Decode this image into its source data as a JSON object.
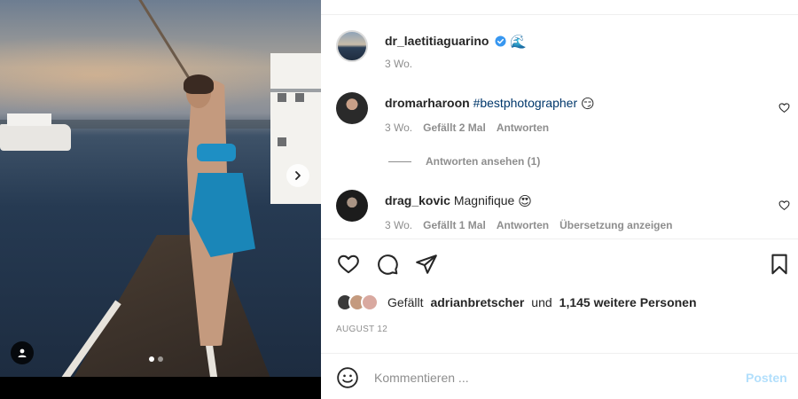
{
  "post": {
    "author": "dr_laetitiaguarino",
    "author_emoji": "🌊",
    "time": "3 Wo."
  },
  "comments": [
    {
      "username": "dromarharoon",
      "text": "#bestphotographer",
      "emoji": "😏",
      "time": "3 Wo.",
      "likes": "Gefällt 2 Mal",
      "reply": "Antworten"
    },
    {
      "username": "drag_kovic",
      "text": "Magnifique",
      "emoji": "😍",
      "time": "3 Wo.",
      "likes": "Gefällt 1 Mal",
      "reply": "Antworten",
      "translate": "Übersetzung anzeigen"
    }
  ],
  "view_replies": "Antworten ansehen (1)",
  "likes": {
    "prefix": "Gefällt",
    "user": "adrianbretscher",
    "middle": "und",
    "count": "1,145 weitere Personen"
  },
  "date": "AUGUST 12",
  "comment_box": {
    "placeholder": "Kommentieren ...",
    "post_label": "Posten"
  },
  "carousel": {
    "slides": 2,
    "active": 1
  },
  "colors": {
    "link": "#00376b",
    "muted": "#8e8e8e",
    "post_disabled": "#b2dffc",
    "verified": "#3897f0"
  },
  "icons": [
    "heart-icon",
    "comment-icon",
    "share-icon",
    "bookmark-icon",
    "emoji-icon",
    "chevron-right-icon",
    "user-tag-icon",
    "verified-badge-icon"
  ]
}
